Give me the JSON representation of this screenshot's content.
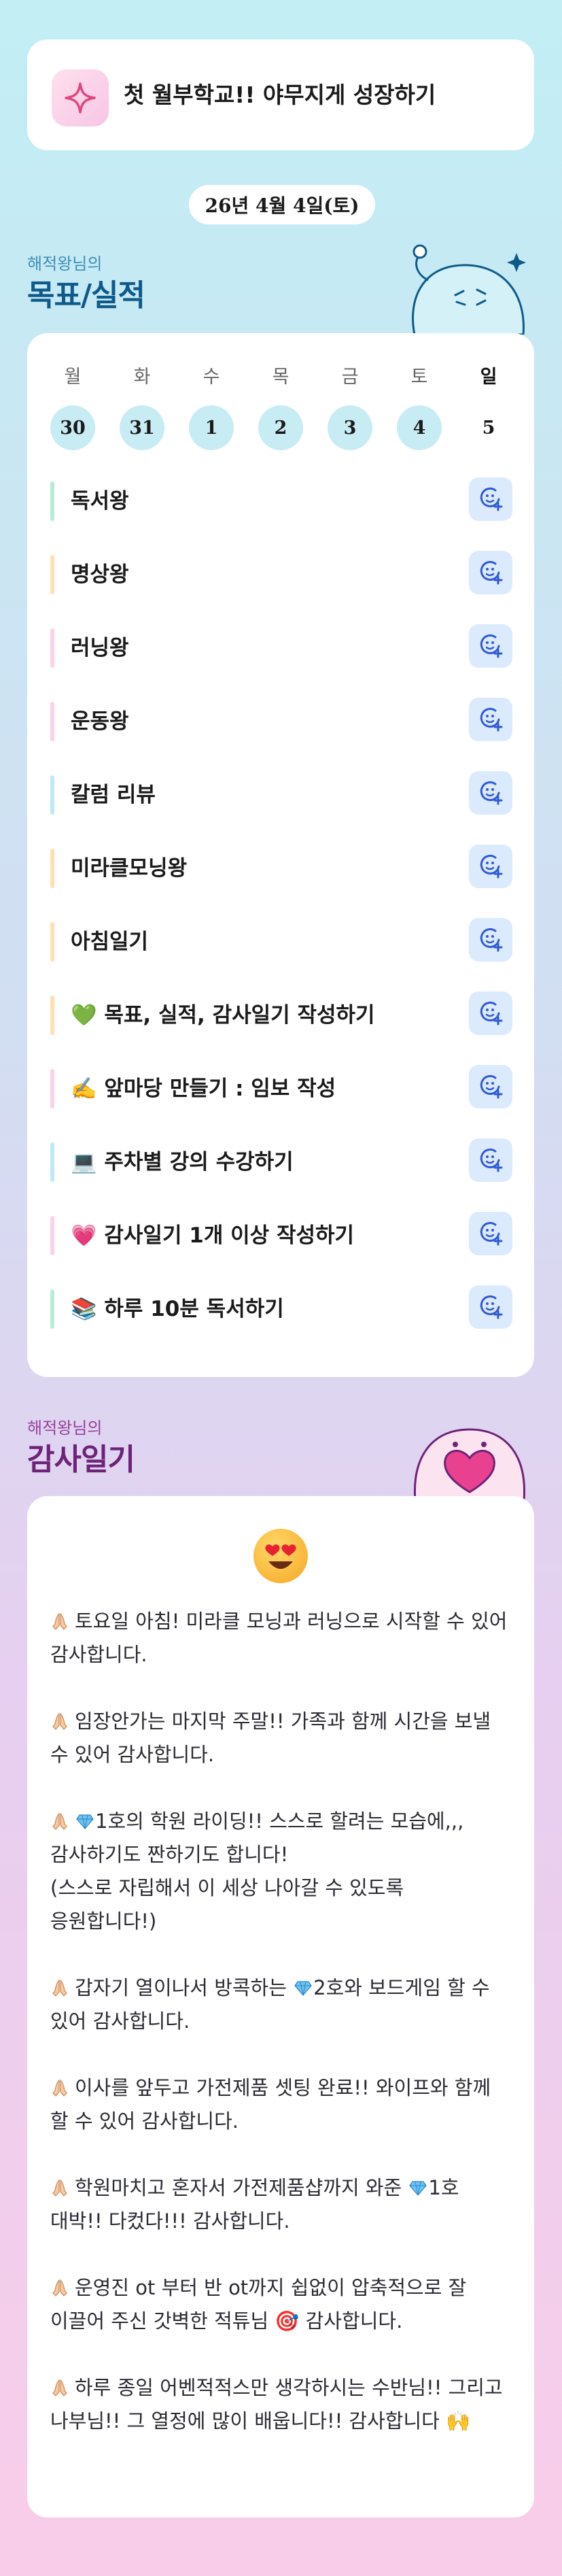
{
  "header": {
    "title": "첫 월부학교!! 야무지게 성장하기",
    "icon": "sparkle-icon"
  },
  "date": "26년 4월 4일(토)",
  "goals_section": {
    "subtitle": "해적왕님의",
    "title": "목표/실적",
    "mascot": "ghost-mascot"
  },
  "week": {
    "days": [
      "월",
      "화",
      "수",
      "목",
      "금",
      "토",
      "일"
    ],
    "dates": [
      "30",
      "31",
      "1",
      "2",
      "3",
      "4",
      "5"
    ],
    "active_index": 6
  },
  "goals": [
    {
      "label": "독서왕",
      "color": "#b7ecd6"
    },
    {
      "label": "명상왕",
      "color": "#ffe0b3"
    },
    {
      "label": "러닝왕",
      "color": "#fbd2e7"
    },
    {
      "label": "운동왕",
      "color": "#fbd2e7"
    },
    {
      "label": "칼럼 리뷰",
      "color": "#bfe9f3"
    },
    {
      "label": "미라클모닝왕",
      "color": "#ffe0b3"
    },
    {
      "label": "아침일기",
      "color": "#ffe0b3"
    },
    {
      "label": "💚 목표, 실적, 감사일기 작성하기",
      "color": "#ffe0b3"
    },
    {
      "label": "✍️ 앞마당 만들기 : 임보 작성",
      "color": "#fbd2e7"
    },
    {
      "label": "💻 주차별 강의 수강하기",
      "color": "#bfe9f3"
    },
    {
      "label": "💗 감사일기 1개 이상 작성하기",
      "color": "#fbd2e7"
    },
    {
      "label": "📚 하루 10분 독서하기",
      "color": "#b7ecd6"
    }
  ],
  "gratitude_section": {
    "subtitle": "해적왕님의",
    "title": "감사일기",
    "mascot": "heart-mascot"
  },
  "gratitude": {
    "emoji": "heart-eyes-emoji",
    "entries": [
      [
        "토요일 아침! 미라클 모닝과 러닝으로 시작할 수 있어 감사합니다."
      ],
      [
        "임장안가는 마지막 주말!! 가족과 함께 시간을 보낼 수 있어 감사합니다."
      ],
      [
        "1호의 학원 라이딩!! 스스로 할려는 모습에,,, 감사하기도 짠하기도 합니다!",
        "(스스로 자립해서 이 세상 나아갈 수 있도록 응원합니다!)"
      ],
      [
        "갑자기 열이나서 방콕하는 ",
        "2호와 보드게임 할 수 있어 감사합니다."
      ],
      [
        "이사를 앞두고 가전제품 셋팅 완료!! 와이프와 함께 할 수 있어 감사합니다."
      ],
      [
        "학원마치고 혼자서 가전제품샵까지 와준 ",
        "1호 대박!! 다컸다!!! 감사합니다."
      ],
      [
        "운영진 ot 부터 반 ot까지 쉽없이 압축적으로 잘 이끌어 주신 갓벽한 적튜님 🎯 감사합니다."
      ],
      [
        "하루 종일 어벤적적스만 생각하시는 수반님!! 그리고 나부님!! 그 열정에 많이 배웁니다!! 감사합니다 🙌"
      ]
    ]
  },
  "colors": {
    "icon_blue": "#2f5bd8",
    "icon_bg": "#dceafd"
  }
}
